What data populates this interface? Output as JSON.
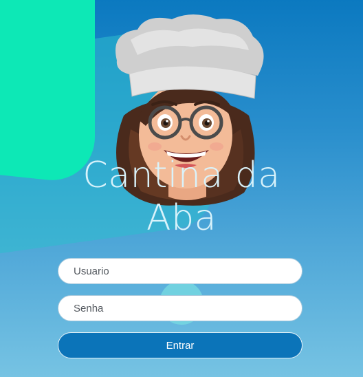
{
  "app": {
    "title_line1": "Cantina da",
    "title_line2": "Aba"
  },
  "form": {
    "username_placeholder": "Usuario",
    "username_value": "",
    "password_placeholder": "Senha",
    "password_value": "",
    "submit_label": "Entrar"
  },
  "colors": {
    "background_top": "#0b79c0",
    "background_bottom": "#76c3e3",
    "accent_green": "#0de8b6",
    "button": "#0b74b9"
  },
  "icons": {
    "avatar": "chef-memoji-avatar"
  }
}
